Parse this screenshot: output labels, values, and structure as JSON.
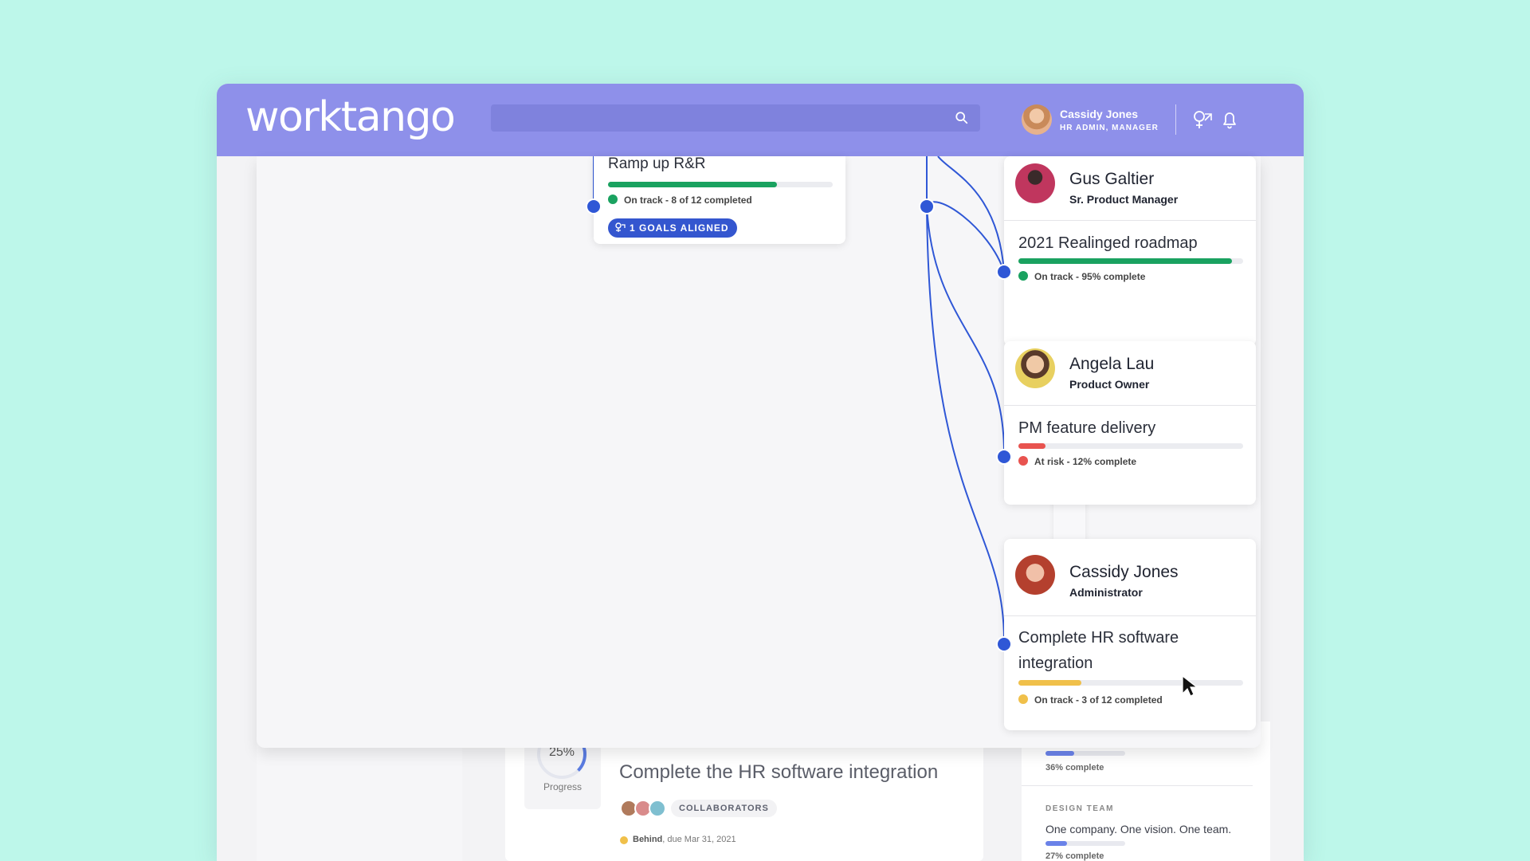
{
  "app": {
    "logo": "worktango",
    "user": {
      "name": "Cassidy Jones",
      "role": "HR ADMIN, MANAGER"
    }
  },
  "background": {
    "progress": {
      "percent": "25%",
      "label": "Progress",
      "value": 0.25
    },
    "goal_title": "Complete the HR software integration",
    "collaborators_label": "COLLABORATORS",
    "status_word": "Behind",
    "status_due": ", due Mar 31, 2021",
    "right": [
      {
        "percent_label": "36% complete",
        "value": 0.36
      },
      {
        "team": "DESIGN TEAM",
        "text": "One company.  One vision.  One team.",
        "percent_label": "27% complete",
        "value": 0.27
      }
    ]
  },
  "alignment": {
    "root_goal": {
      "title": "Ramp up R&R",
      "progress": 0.75,
      "status": "On track - 8 of 12 completed",
      "status_color": "#1aa260",
      "aligned_label": "1 GOALS ALIGNED"
    },
    "cards": [
      {
        "name": "Gus Galtier",
        "title": "Sr. Product Manager",
        "goal": "2021 Realinged roadmap",
        "progress": 0.95,
        "status": "On track - 95% complete",
        "color": "#1aa260"
      },
      {
        "name": "Angela Lau",
        "title": "Product Owner",
        "goal": "PM feature delivery",
        "progress": 0.12,
        "status": "At risk - 12% complete",
        "color": "#e8534f"
      },
      {
        "name": "Cassidy Jones",
        "title": "Administrator",
        "goal": "Complete HR software integration",
        "progress": 0.28,
        "status": "On track - 3 of 12 completed",
        "color": "#f0c04a"
      }
    ]
  },
  "colors": {
    "topbar": "#8e90ea",
    "accent": "#2f57d6",
    "background": "#bdf7ea"
  },
  "icons": [
    "search-icon",
    "aligned-goals-icon",
    "bell-icon",
    "cursor-icon"
  ]
}
